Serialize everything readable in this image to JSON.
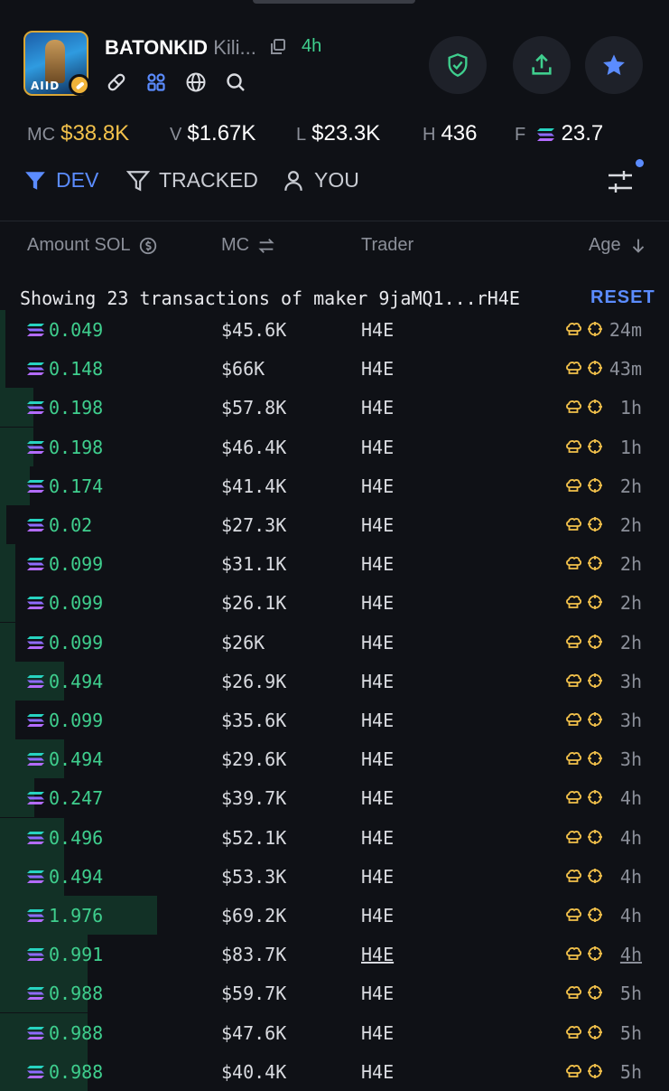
{
  "token": {
    "symbol": "BATONKID",
    "name_truncated": "Kili...",
    "age": "4h",
    "avatar_text": "AIID"
  },
  "stats": [
    {
      "label": "MC",
      "value": "$38.8K",
      "highlight": true
    },
    {
      "label": "V",
      "value": "$1.67K",
      "highlight": false
    },
    {
      "label": "L",
      "value": "$23.3K",
      "highlight": false
    },
    {
      "label": "H",
      "value": "436",
      "highlight": false
    },
    {
      "label": "F",
      "value": "23.7",
      "highlight": false
    }
  ],
  "filters": [
    {
      "label": "DEV",
      "active": true
    },
    {
      "label": "TRACKED",
      "active": false
    },
    {
      "label": "YOU",
      "active": false
    }
  ],
  "columns": {
    "amount": "Amount SOL",
    "mc": "MC",
    "trader": "Trader",
    "age": "Age"
  },
  "info": {
    "text": "Showing 23 transactions of maker 9jaMQ1...rH4E",
    "reset": "RESET"
  },
  "colors": {
    "accent_blue": "#5b8cff",
    "buy_green": "#3fcf8e",
    "gold": "#f2c14b",
    "background": "#0f1116"
  },
  "rows": [
    {
      "amount": "0.049",
      "mc": "$45.6K",
      "trader": "H4E",
      "age": "24m",
      "volume_fraction": 0.01
    },
    {
      "amount": "0.148",
      "mc": "$66K",
      "trader": "H4E",
      "age": "43m",
      "volume_fraction": 0.03
    },
    {
      "amount": "0.198",
      "mc": "$57.8K",
      "trader": "H4E",
      "age": "1h",
      "volume_fraction": 0.21
    },
    {
      "amount": "0.198",
      "mc": "$46.4K",
      "trader": "H4E",
      "age": "1h",
      "volume_fraction": 0.21
    },
    {
      "amount": "0.174",
      "mc": "$41.4K",
      "trader": "H4E",
      "age": "2h",
      "volume_fraction": 0.19
    },
    {
      "amount": "0.02",
      "mc": "$27.3K",
      "trader": "H4E",
      "age": "2h",
      "volume_fraction": 0.04
    },
    {
      "amount": "0.099",
      "mc": "$31.1K",
      "trader": "H4E",
      "age": "2h",
      "volume_fraction": 0.1
    },
    {
      "amount": "0.099",
      "mc": "$26.1K",
      "trader": "H4E",
      "age": "2h",
      "volume_fraction": 0.1
    },
    {
      "amount": "0.099",
      "mc": "$26K",
      "trader": "H4E",
      "age": "2h",
      "volume_fraction": 0.1
    },
    {
      "amount": "0.494",
      "mc": "$26.9K",
      "trader": "H4E",
      "age": "3h",
      "volume_fraction": 0.41
    },
    {
      "amount": "0.099",
      "mc": "$35.6K",
      "trader": "H4E",
      "age": "3h",
      "volume_fraction": 0.1
    },
    {
      "amount": "0.494",
      "mc": "$29.6K",
      "trader": "H4E",
      "age": "3h",
      "volume_fraction": 0.41
    },
    {
      "amount": "0.247",
      "mc": "$39.7K",
      "trader": "H4E",
      "age": "4h",
      "volume_fraction": 0.22
    },
    {
      "amount": "0.496",
      "mc": "$52.1K",
      "trader": "H4E",
      "age": "4h",
      "volume_fraction": 0.41
    },
    {
      "amount": "0.494",
      "mc": "$53.3K",
      "trader": "H4E",
      "age": "4h",
      "volume_fraction": 0.41
    },
    {
      "amount": "1.976",
      "mc": "$69.2K",
      "trader": "H4E",
      "age": "4h",
      "volume_fraction": 1.0
    },
    {
      "amount": "0.991",
      "mc": "$83.7K",
      "trader": "H4E",
      "age": "4h",
      "volume_fraction": 0.56,
      "hovered": true
    },
    {
      "amount": "0.988",
      "mc": "$59.7K",
      "trader": "H4E",
      "age": "5h",
      "volume_fraction": 0.56
    },
    {
      "amount": "0.988",
      "mc": "$47.6K",
      "trader": "H4E",
      "age": "5h",
      "volume_fraction": 0.56
    },
    {
      "amount": "0.988",
      "mc": "$40.4K",
      "trader": "H4E",
      "age": "5h",
      "volume_fraction": 0.56
    }
  ]
}
